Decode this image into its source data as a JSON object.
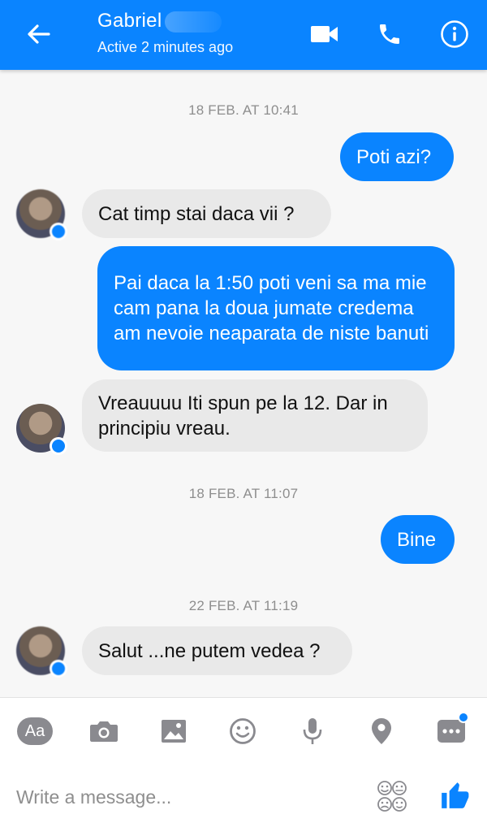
{
  "header": {
    "name": "Gabriel",
    "status": "Active 2 minutes ago",
    "icons": [
      "back-arrow-icon",
      "video-call-icon",
      "phone-icon",
      "info-icon"
    ]
  },
  "conversation": {
    "timestamps": [
      "18 FEB. AT 10:41",
      "18 FEB. AT 11:07",
      "22 FEB. AT 11:19"
    ],
    "messages": [
      {
        "direction": "out",
        "text": "Poti azi?"
      },
      {
        "direction": "in",
        "text": "Cat timp stai daca vii ?"
      },
      {
        "direction": "out",
        "text": "Pai daca la 1:50 poti veni sa ma mie cam pana la doua jumate credema am nevoie neaparata de niste banuti"
      },
      {
        "direction": "in",
        "text": "Vreauuuu Iti spun pe la 12. Dar in principiu vreau."
      },
      {
        "direction": "out",
        "text": "Bine"
      },
      {
        "direction": "in",
        "text": "Salut ...ne putem vedea ?"
      }
    ]
  },
  "composer": {
    "aa_label": "Aa",
    "placeholder": "Write a message...",
    "tool_icons": [
      "text-style-icon",
      "camera-icon",
      "gallery-icon",
      "smiley-icon",
      "microphone-icon",
      "location-pin-icon",
      "more-icon"
    ]
  },
  "colors": {
    "accent": "#0a84ff",
    "incoming_bubble": "#e9e9e9",
    "background": "#f7f7f7"
  }
}
